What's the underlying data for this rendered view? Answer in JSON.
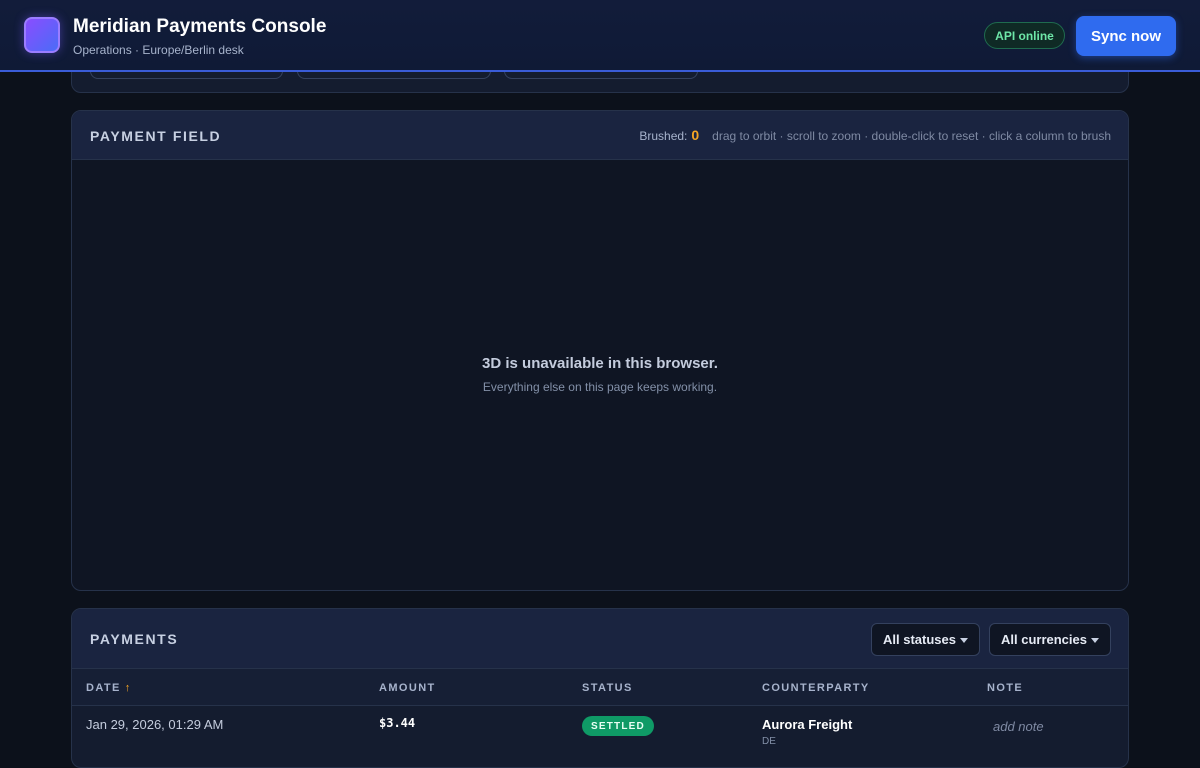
{
  "header": {
    "title": "Meridian Payments Console",
    "subtitle": "Operations · Europe/Berlin desk",
    "api_status": "API online",
    "sync_label": "Sync now"
  },
  "field": {
    "title": "PAYMENT FIELD",
    "brushed_label": "Brushed:",
    "brushed_count": "0",
    "hint": "drag to orbit · scroll to zoom · double-click to reset · click a column to brush",
    "message": "3D is unavailable in this browser.",
    "submessage": "Everything else on this page keeps working."
  },
  "payments": {
    "title": "PAYMENTS",
    "status_filter": "All statuses",
    "currency_filter": "All currencies",
    "columns": {
      "date": "DATE",
      "amount": "AMOUNT",
      "status": "STATUS",
      "counterparty": "COUNTERPARTY",
      "note": "NOTE"
    },
    "sort_icon": "↑",
    "rows": [
      {
        "date": "Jan 29, 2026, 01:29 AM",
        "amount": "$3.44",
        "status": "SETTLED",
        "counterparty": "Aurora Freight",
        "country": "DE",
        "note": "add note"
      }
    ]
  },
  "colors": {
    "accent": "#2f6bef",
    "brush": "#f5a524",
    "settled": "#0f9a66",
    "online": "#6ee7a8"
  }
}
